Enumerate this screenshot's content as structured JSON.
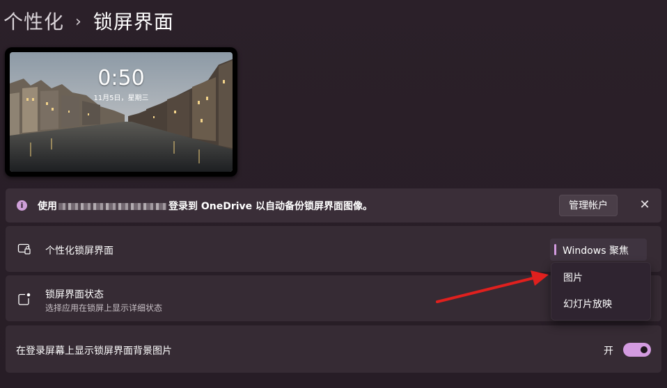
{
  "breadcrumb": {
    "parent": "个性化",
    "separator": "›",
    "current": "锁屏界面"
  },
  "preview": {
    "time": "0:50",
    "date": "11月5日，星期三"
  },
  "onedrive_banner": {
    "text_prefix": "使用",
    "text_suffix": "登录到 OneDrive 以自动备份锁屏界面图像。",
    "manage_button": "管理帐户",
    "close_glyph": "✕",
    "info_glyph": "i",
    "accent": "#cfa0d9"
  },
  "settings": {
    "personalize": {
      "title": "个性化锁屏界面",
      "selected": "Windows 聚焦",
      "options": [
        "图片",
        "幻灯片放映"
      ]
    },
    "status": {
      "title": "锁屏界面状态",
      "subtitle": "选择应用在锁屏上显示详细状态"
    },
    "signin_bg": {
      "title": "在登录屏幕上显示锁屏界面背景图片",
      "toggle_label": "开",
      "toggle_on": true
    }
  },
  "colors": {
    "accent": "#d39be0",
    "annotation_arrow": "#e0201e"
  }
}
